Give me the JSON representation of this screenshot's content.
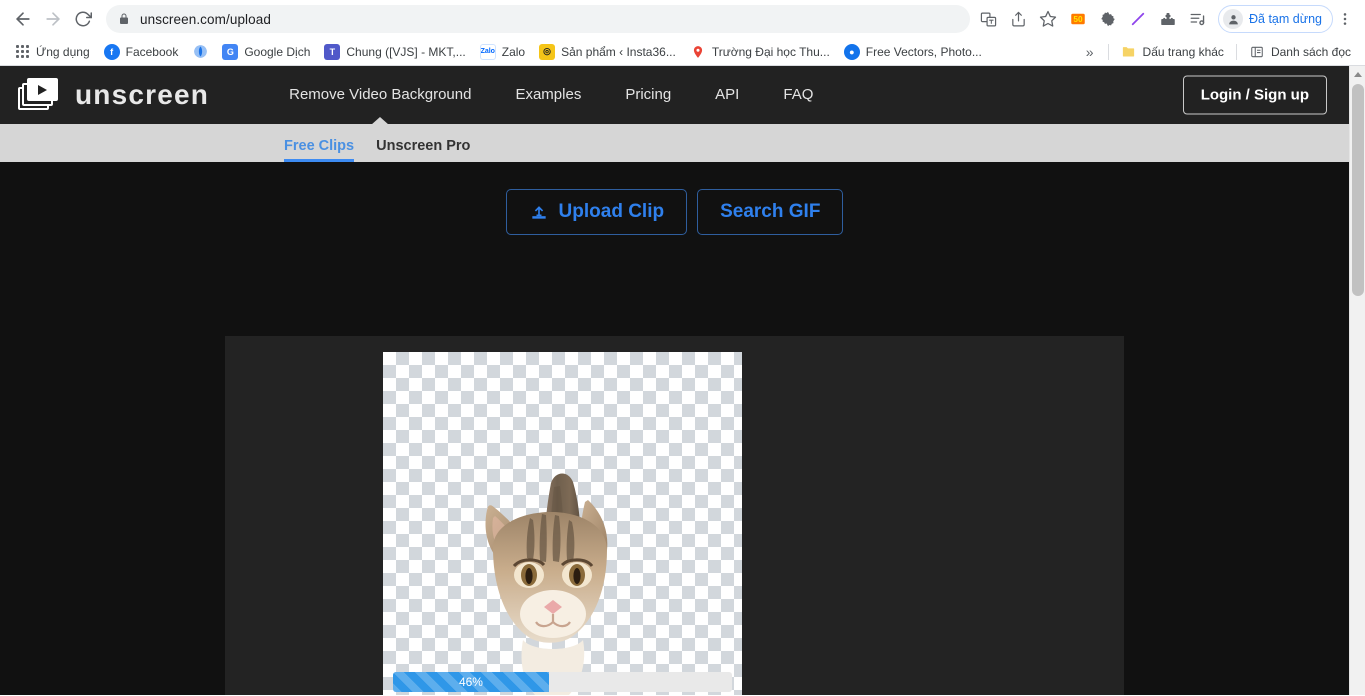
{
  "browser": {
    "back_icon": "back-arrow-icon",
    "forward_icon": "forward-arrow-icon",
    "reload_icon": "reload-icon",
    "lock_icon": "lock-icon",
    "url": "unscreen.com/upload",
    "toolbar_icons": [
      {
        "name": "translate-icon",
        "glyph": "文"
      },
      {
        "name": "share-icon",
        "glyph": "⤴"
      },
      {
        "name": "bookmark-star-icon",
        "glyph": "☆"
      },
      {
        "name": "extension-coupon-icon",
        "glyph": "50"
      },
      {
        "name": "extension-gear-icon",
        "glyph": "⚙"
      },
      {
        "name": "extension-feather-icon",
        "glyph": "✒"
      },
      {
        "name": "extensions-puzzle-icon",
        "glyph": "🧩"
      },
      {
        "name": "media-list-icon",
        "glyph": "♪"
      }
    ],
    "profile": {
      "avatar_icon": "user-avatar-icon",
      "label": "Đã tạm dừng"
    },
    "menu_icon": "kebab-menu-icon"
  },
  "bookmarks": {
    "apps_label": "Ứng dụng",
    "items": [
      {
        "label": "Facebook",
        "icon": "facebook-icon",
        "color": "#1877f2",
        "glyph": "f"
      },
      {
        "label": "Google Dịch",
        "icon": "globe-icon",
        "color": "#1a73e8",
        "glyph": "●"
      },
      {
        "label": "Google Dịch",
        "icon": "google-translate-icon",
        "color": "#4285f4",
        "glyph": "G"
      },
      {
        "label": "Chung ([VJS] - MKT,...",
        "icon": "teams-icon",
        "color": "#5059c9",
        "glyph": "T"
      },
      {
        "label": "Zalo",
        "icon": "zalo-icon",
        "color": "#ffffff",
        "glyph": "Z"
      },
      {
        "label": "Sản phẩm ‹ Insta36...",
        "icon": "insta360-icon",
        "color": "#f5c518",
        "glyph": "◎"
      },
      {
        "label": "Trường Đại học Thu...",
        "icon": "map-pin-icon",
        "color": "#ea4335",
        "glyph": "●"
      },
      {
        "label": "Free Vectors, Photo...",
        "icon": "freepik-icon",
        "color": "#1273eb",
        "glyph": "●"
      }
    ],
    "overflow_icon": "chevron-double-right-icon",
    "overflow_glyph": "»",
    "other_bookmarks": {
      "label": "Dấu trang khác",
      "icon": "folder-icon"
    },
    "reading_list": {
      "label": "Danh sách đọc",
      "icon": "reading-list-icon"
    }
  },
  "site": {
    "logo_text": "unscreen",
    "logo_icon": "unscreen-play-logo-icon",
    "nav": [
      {
        "label": "Remove Video Background",
        "active": true
      },
      {
        "label": "Examples",
        "active": false
      },
      {
        "label": "Pricing",
        "active": false
      },
      {
        "label": "API",
        "active": false
      },
      {
        "label": "FAQ",
        "active": false
      }
    ],
    "login_label": "Login / Sign up",
    "tabs": [
      {
        "label": "Free Clips",
        "active": true
      },
      {
        "label": "Unscreen Pro",
        "active": false
      }
    ],
    "actions": {
      "upload_label": "Upload Clip",
      "upload_icon": "upload-icon",
      "search_gif_label": "Search GIF"
    },
    "clip": {
      "progress_percent": 46,
      "progress_label": "46%",
      "canvas_alt": "kitten-transparent-checkerboard-preview"
    },
    "colors": {
      "accent_blue": "#2f80ed",
      "tab_active": "#4a90e2",
      "header_bg": "#222222",
      "page_bg": "#111111",
      "panel_bg": "#232323",
      "subnav_bg": "#d6d6d6",
      "progress_fill": "#2f97e8"
    }
  }
}
